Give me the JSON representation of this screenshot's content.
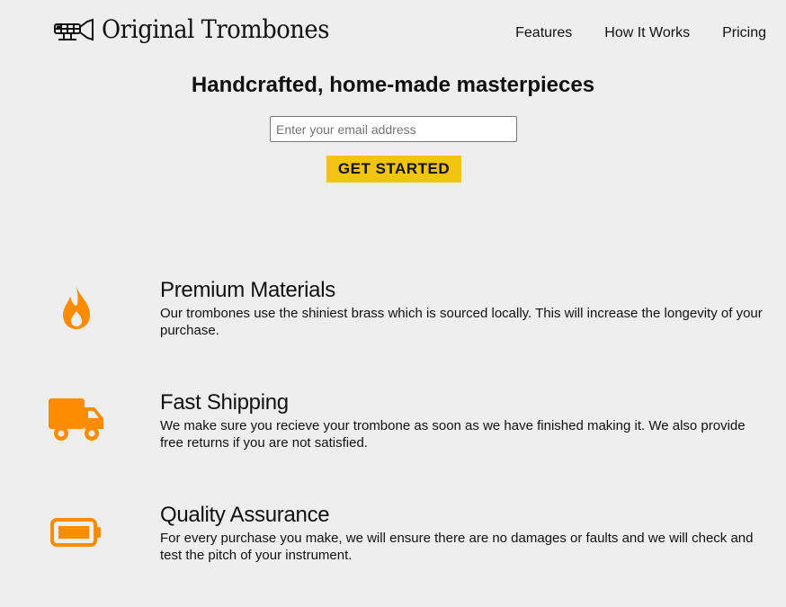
{
  "header": {
    "logo_text": "Original Trombones",
    "logo_icon": "trombone-icon",
    "nav": [
      {
        "label": "Features"
      },
      {
        "label": "How It Works"
      },
      {
        "label": "Pricing"
      }
    ]
  },
  "hero": {
    "title": "Handcrafted, home-made masterpieces",
    "email_placeholder": "Enter your email address",
    "cta_label": "GET STARTED",
    "cta_color": "#f1c40f"
  },
  "features": [
    {
      "icon": "fire-icon",
      "title": "Premium Materials",
      "description": "Our trombones use the shiniest brass which is sourced locally. This will increase the longevity of your purchase."
    },
    {
      "icon": "truck-icon",
      "title": "Fast Shipping",
      "description": "We make sure you recieve your trombone as soon as we have finished making it. We also provide free returns if you are not satisfied."
    },
    {
      "icon": "battery-icon",
      "title": "Quality Assurance",
      "description": "For every purchase you make, we will ensure there are no damages or faults and we will check and test the pitch of your instrument."
    }
  ],
  "colors": {
    "accent_orange": "#ff8c00",
    "background": "#eeeeee"
  }
}
